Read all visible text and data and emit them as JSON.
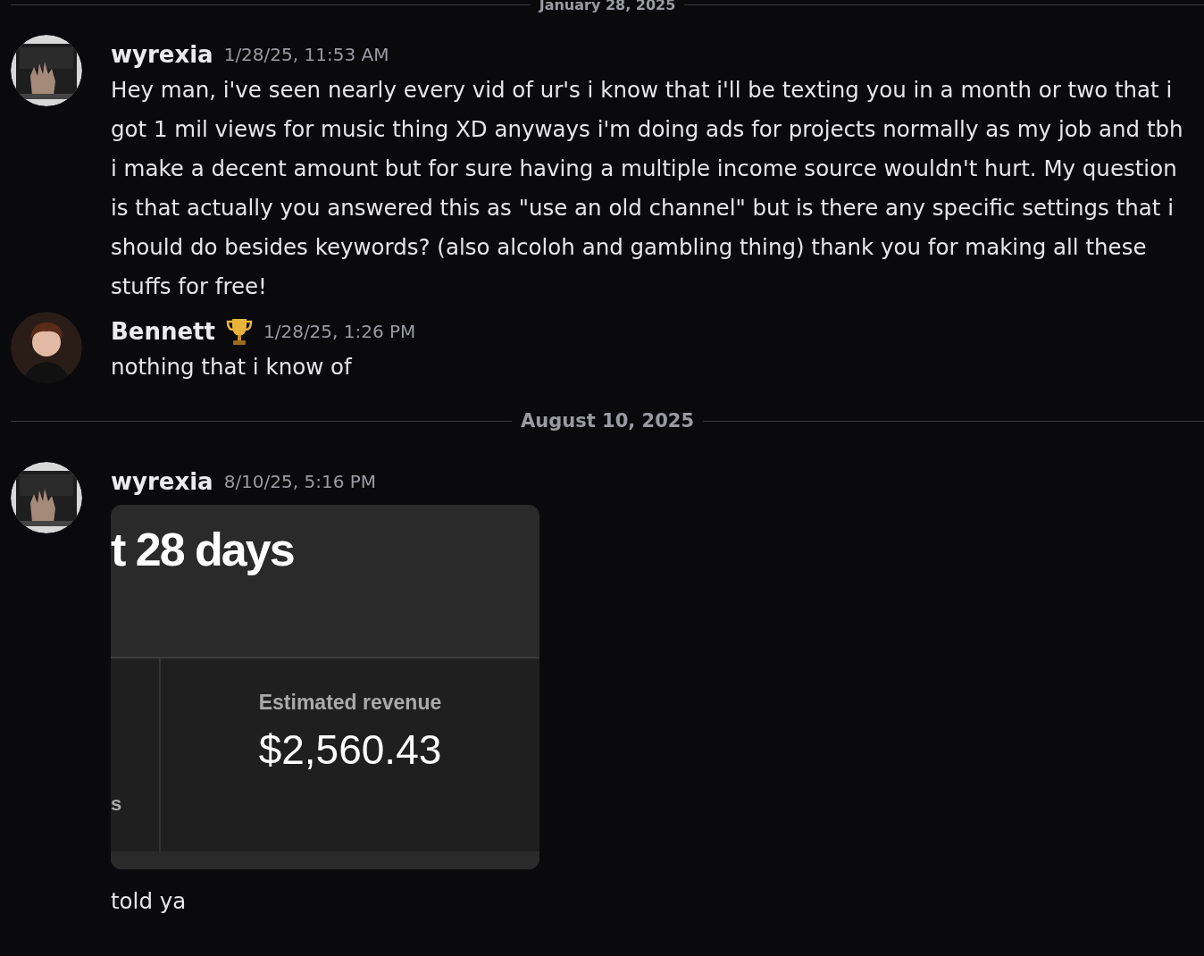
{
  "feed": [
    {
      "kind": "divider",
      "label": "January 28, 2025"
    },
    {
      "kind": "message",
      "author": "wyrexia",
      "trophy": false,
      "timestamp": "1/28/25, 11:53 AM",
      "text": "Hey man, i've seen nearly every vid of ur's i know that i'll be texting you in a month or two that i got 1 mil views for music thing XD anyways i'm doing ads for projects normally as my job and tbh i make a decent amount but for sure having a multiple income source wouldn't hurt. My question is that actually you answered this as \"use an old channel\" but is there any specific settings that i should do besides keywords? (also alcoloh and gambling thing) thank you for making all these stuffs for free!"
    },
    {
      "kind": "message",
      "author": "Bennett",
      "trophy": true,
      "avatar": {
        "kind": "person"
      },
      "timestamp": "1/28/25, 1:26 PM",
      "text": "nothing that i know of"
    },
    {
      "kind": "divider",
      "label": "August 10, 2025"
    },
    {
      "kind": "message",
      "author": "wyrexia",
      "trophy": false,
      "timestamp": "8/10/25, 5:16 PM",
      "attachment": {
        "heading": "t 28 days",
        "side_label": "s",
        "metric_label": "Estimated revenue",
        "metric_value": "$2,560.43"
      },
      "text": "told ya"
    }
  ]
}
